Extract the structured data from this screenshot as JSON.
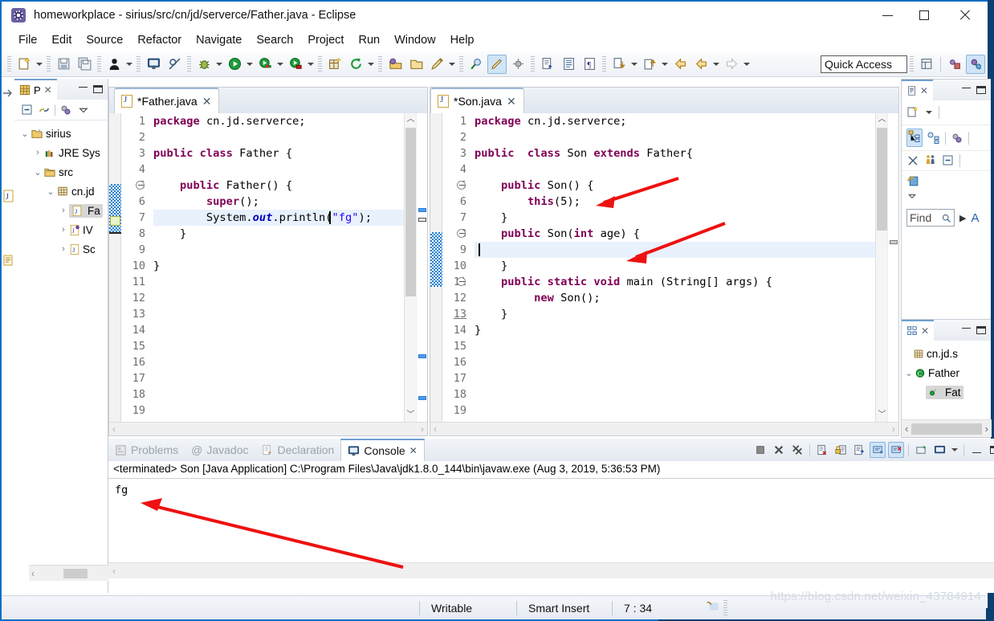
{
  "window": {
    "title": "homeworkplace - sirius/src/cn/jd/serverce/Father.java - Eclipse",
    "app_icon": "eclipse-icon",
    "minimize": "minimize-icon",
    "maximize": "maximize-icon",
    "close": "close-icon"
  },
  "menu": [
    "File",
    "Edit",
    "Source",
    "Refactor",
    "Navigate",
    "Search",
    "Project",
    "Run",
    "Window",
    "Help"
  ],
  "toolbar": {
    "quick_access": "Quick Access",
    "items": [
      "new-wizard-icon",
      "save-icon",
      "save-all-icon",
      "person-icon",
      "console-view-icon",
      "skip-breakpoints-icon",
      "debug-icon",
      "run-icon",
      "run-last-icon",
      "coverage-icon",
      "new-java-package-icon",
      "refresh-icon",
      "open-type-icon",
      "open-task-icon",
      "pencil-icon",
      "search-icon",
      "highlight-icon",
      "annotation-icon",
      "next-annotation-icon",
      "previous-annotation-icon",
      "back-icon",
      "forward-icon"
    ]
  },
  "package_explorer": {
    "tab_label": "P",
    "tab_icon": "package-explorer-icon",
    "tools": [
      "collapse-all-icon",
      "link-with-editor-icon",
      "view-menu-icon",
      "minimize-icon"
    ],
    "tree": [
      {
        "label": "sirius",
        "icon": "project-icon",
        "indent": 0,
        "twist": "v",
        "selected": false
      },
      {
        "label": "JRE Sys",
        "icon": "library-icon",
        "indent": 1,
        "twist": ">",
        "selected": false
      },
      {
        "label": "src",
        "icon": "source-folder-icon",
        "indent": 1,
        "twist": "v",
        "selected": false
      },
      {
        "label": "cn.jd",
        "icon": "package-icon",
        "indent": 2,
        "twist": "v",
        "selected": false
      },
      {
        "label": "Fa",
        "icon": "java-file-icon",
        "indent": 3,
        "twist": ">",
        "selected": true
      },
      {
        "label": "IV",
        "icon": "java-interface-icon",
        "indent": 3,
        "twist": ">",
        "selected": false
      },
      {
        "label": "Sc",
        "icon": "java-file-icon",
        "indent": 3,
        "twist": ">",
        "selected": false
      }
    ]
  },
  "editors": [
    {
      "tab_label": "*Father.java",
      "tab_icon": "java-file-icon",
      "close_icon": "close-icon",
      "dirty": true,
      "cursor_line": 7,
      "lines": [
        {
          "n": 1,
          "fold": false,
          "tokens": [
            {
              "t": "package ",
              "c": "kw"
            },
            {
              "t": "cn.jd.serverce;",
              "c": ""
            }
          ]
        },
        {
          "n": 2,
          "fold": false,
          "tokens": []
        },
        {
          "n": 3,
          "fold": false,
          "tokens": [
            {
              "t": "public class ",
              "c": "kw"
            },
            {
              "t": "Father {",
              "c": ""
            }
          ]
        },
        {
          "n": 4,
          "fold": false,
          "tokens": []
        },
        {
          "n": 5,
          "fold": true,
          "tokens": [
            {
              "t": "    ",
              "c": ""
            },
            {
              "t": "public ",
              "c": "kw"
            },
            {
              "t": "Father() {",
              "c": ""
            }
          ]
        },
        {
          "n": 6,
          "fold": false,
          "tokens": [
            {
              "t": "        ",
              "c": ""
            },
            {
              "t": "super",
              "c": "kw"
            },
            {
              "t": "();",
              "c": ""
            }
          ]
        },
        {
          "n": 7,
          "fold": false,
          "hl": true,
          "tokens": [
            {
              "t": "        System.",
              "c": ""
            },
            {
              "t": "out",
              "c": "fld"
            },
            {
              "t": ".println(",
              "c": ""
            },
            {
              "t": "\"fg\"",
              "c": "str"
            },
            {
              "t": ");",
              "c": ""
            }
          ]
        },
        {
          "n": 8,
          "fold": false,
          "tokens": [
            {
              "t": "    }",
              "c": ""
            }
          ]
        },
        {
          "n": 9,
          "fold": false,
          "tokens": []
        },
        {
          "n": 10,
          "fold": false,
          "tokens": [
            {
              "t": "}",
              "c": ""
            }
          ]
        },
        {
          "n": 11,
          "fold": false,
          "tokens": []
        },
        {
          "n": 12,
          "fold": false,
          "tokens": []
        },
        {
          "n": 13,
          "fold": false,
          "tokens": []
        },
        {
          "n": 14,
          "fold": false,
          "tokens": []
        },
        {
          "n": 15,
          "fold": false,
          "tokens": []
        },
        {
          "n": 16,
          "fold": false,
          "tokens": []
        },
        {
          "n": 17,
          "fold": false,
          "tokens": []
        },
        {
          "n": 18,
          "fold": false,
          "tokens": []
        },
        {
          "n": 19,
          "fold": false,
          "tokens": []
        }
      ]
    },
    {
      "tab_label": "*Son.java",
      "tab_icon": "java-file-icon",
      "close_icon": "close-icon",
      "dirty": true,
      "cursor_line": 9,
      "lines": [
        {
          "n": 1,
          "fold": false,
          "tokens": [
            {
              "t": "package ",
              "c": "kw"
            },
            {
              "t": "cn.jd.serverce;",
              "c": ""
            }
          ]
        },
        {
          "n": 2,
          "fold": false,
          "tokens": []
        },
        {
          "n": 3,
          "fold": false,
          "tokens": [
            {
              "t": "public  class ",
              "c": "kw"
            },
            {
              "t": "Son ",
              "c": ""
            },
            {
              "t": "extends ",
              "c": "kw"
            },
            {
              "t": "Father{",
              "c": ""
            }
          ]
        },
        {
          "n": 4,
          "fold": false,
          "tokens": []
        },
        {
          "n": 5,
          "fold": true,
          "tokens": [
            {
              "t": "    ",
              "c": ""
            },
            {
              "t": "public ",
              "c": "kw"
            },
            {
              "t": "Son() {",
              "c": ""
            }
          ]
        },
        {
          "n": 6,
          "fold": false,
          "tokens": [
            {
              "t": "        ",
              "c": ""
            },
            {
              "t": "this",
              "c": "kw"
            },
            {
              "t": "(5);",
              "c": ""
            }
          ]
        },
        {
          "n": 7,
          "fold": false,
          "tokens": [
            {
              "t": "    }",
              "c": ""
            }
          ]
        },
        {
          "n": 8,
          "fold": true,
          "tokens": [
            {
              "t": "    ",
              "c": ""
            },
            {
              "t": "public ",
              "c": "kw"
            },
            {
              "t": "Son(",
              "c": ""
            },
            {
              "t": "int ",
              "c": "kw"
            },
            {
              "t": "age) {",
              "c": ""
            }
          ]
        },
        {
          "n": 9,
          "fold": false,
          "hl": true,
          "tokens": []
        },
        {
          "n": 10,
          "fold": false,
          "tokens": [
            {
              "t": "    }",
              "c": ""
            }
          ]
        },
        {
          "n": 11,
          "fold": true,
          "tokens": [
            {
              "t": "    ",
              "c": ""
            },
            {
              "t": "public static void ",
              "c": "kw"
            },
            {
              "t": "main (String[] args) {",
              "c": ""
            }
          ]
        },
        {
          "n": 12,
          "fold": false,
          "tokens": [
            {
              "t": "         ",
              "c": ""
            },
            {
              "t": "new ",
              "c": "kw"
            },
            {
              "t": "Son();",
              "c": ""
            }
          ]
        },
        {
          "n": 13,
          "fold": false,
          "tokens": [
            {
              "t": "    }",
              "c": ""
            }
          ]
        },
        {
          "n": 14,
          "fold": false,
          "tokens": [
            {
              "t": "}",
              "c": ""
            }
          ]
        },
        {
          "n": 15,
          "fold": false,
          "tokens": []
        },
        {
          "n": 16,
          "fold": false,
          "tokens": []
        },
        {
          "n": 17,
          "fold": false,
          "tokens": []
        },
        {
          "n": 18,
          "fold": false,
          "tokens": []
        },
        {
          "n": 19,
          "fold": false,
          "tokens": []
        }
      ]
    }
  ],
  "console": {
    "tabs": [
      {
        "label": "Problems",
        "icon": "problems-icon",
        "active": false
      },
      {
        "label": "Javadoc",
        "icon": "javadoc-icon",
        "active": false
      },
      {
        "label": "Declaration",
        "icon": "declaration-icon",
        "active": false
      },
      {
        "label": "Console",
        "icon": "console-icon",
        "active": true
      }
    ],
    "close_icon": "close-icon",
    "tools": [
      "terminate-icon",
      "remove-launch-icon",
      "remove-all-icon",
      "clear-console-icon",
      "scroll-lock-icon",
      "word-wrap-icon",
      "show-console-on-output-icon",
      "show-console-on-error-icon",
      "pin-console-icon",
      "display-selected-console-icon",
      "view-menu-icon",
      "minimize-icon",
      "maximize-icon"
    ],
    "header": "<terminated> Son [Java Application] C:\\Program Files\\Java\\jdk1.8.0_144\\bin\\javaw.exe (Aug 3, 2019, 5:36:53 PM)",
    "output": "fg"
  },
  "right_views": {
    "outline_top": {
      "tab_icon": "javadoc-view-icon",
      "tools_row1": [
        "new-doc-icon",
        "dropdown-icon"
      ],
      "tools_row2": [
        "hierarchy-icon",
        "history-icon",
        "members-icon"
      ],
      "tools_row3": [
        "hide-fields-icon",
        "hide-static-icon",
        "collapse-icon"
      ],
      "tools_row4": [
        "refresh-icon",
        "view-menu-icon"
      ],
      "find_label": "Find",
      "find_icon": "search-icon",
      "find_next_icon": "play-icon",
      "find_letter": "A"
    },
    "outline_bottom": {
      "tab_icon": "outline-icon",
      "tools": [
        "sort-icon",
        "collapse-all-icon",
        "sort-az-icon",
        "hide-nonpublic-icon",
        "hide-static-icon",
        "hide-fields-icon",
        "hide-local-icon",
        "view-menu-icon"
      ],
      "tree": [
        {
          "label": "cn.jd.s",
          "icon": "package-icon",
          "indent": 1,
          "twist": "",
          "selected": false
        },
        {
          "label": "Father",
          "icon": "class-icon",
          "indent": 0,
          "twist": "v",
          "selected": false
        },
        {
          "label": "Fat",
          "icon": "constructor-icon",
          "indent": 2,
          "twist": "",
          "selected": true
        }
      ]
    }
  },
  "statusbar": {
    "writable": "Writable",
    "insert_mode": "Smart Insert",
    "position": "7 : 34",
    "icon": "editor-status-icon"
  },
  "watermark": "https://blog.csdn.net/weixin_43784914",
  "colors": {
    "accent_blue": "#0a6ec4",
    "annotation_red": "#ee1111",
    "keyword": "#7f0055",
    "string": "#2a00ff",
    "field": "#0000c0",
    "selection": "#e8f1fc"
  }
}
